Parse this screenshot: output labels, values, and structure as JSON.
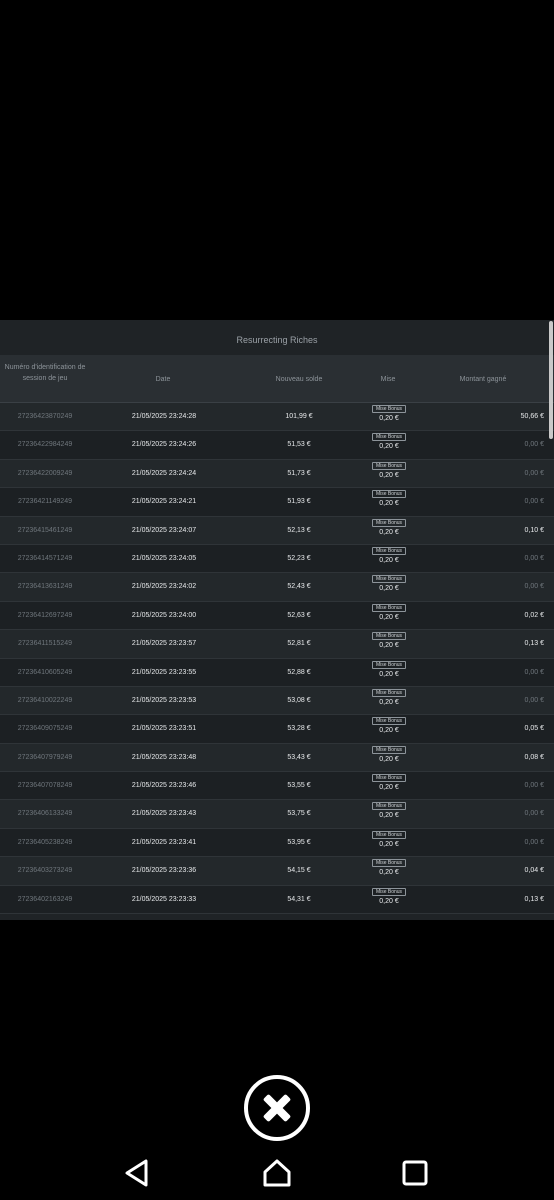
{
  "panel": {
    "title": "Resurrecting Riches",
    "headers": {
      "id": "Numéro d'identification de session de jeu",
      "date": "Date",
      "solde": "Nouveau solde",
      "mise": "Mise",
      "gain": "Montant gagné"
    },
    "mise_badge": "Mise Bonus",
    "rows": [
      {
        "id": "27236423870249",
        "date": "21/05/2025 23:24:28",
        "solde": "101,99 €",
        "mise": "0,20 €",
        "gain": "50,66 €"
      },
      {
        "id": "27236422984249",
        "date": "21/05/2025 23:24:26",
        "solde": "51,53 €",
        "mise": "0,20 €",
        "gain": "0,00 €"
      },
      {
        "id": "27236422009249",
        "date": "21/05/2025 23:24:24",
        "solde": "51,73 €",
        "mise": "0,20 €",
        "gain": "0,00 €"
      },
      {
        "id": "27236421149249",
        "date": "21/05/2025 23:24:21",
        "solde": "51,93 €",
        "mise": "0,20 €",
        "gain": "0,00 €"
      },
      {
        "id": "27236415461249",
        "date": "21/05/2025 23:24:07",
        "solde": "52,13 €",
        "mise": "0,20 €",
        "gain": "0,10 €"
      },
      {
        "id": "27236414571249",
        "date": "21/05/2025 23:24:05",
        "solde": "52,23 €",
        "mise": "0,20 €",
        "gain": "0,00 €"
      },
      {
        "id": "27236413631249",
        "date": "21/05/2025 23:24:02",
        "solde": "52,43 €",
        "mise": "0,20 €",
        "gain": "0,00 €"
      },
      {
        "id": "27236412697249",
        "date": "21/05/2025 23:24:00",
        "solde": "52,63 €",
        "mise": "0,20 €",
        "gain": "0,02 €"
      },
      {
        "id": "27236411515249",
        "date": "21/05/2025 23:23:57",
        "solde": "52,81 €",
        "mise": "0,20 €",
        "gain": "0,13 €"
      },
      {
        "id": "27236410605249",
        "date": "21/05/2025 23:23:55",
        "solde": "52,88 €",
        "mise": "0,20 €",
        "gain": "0,00 €"
      },
      {
        "id": "27236410022249",
        "date": "21/05/2025 23:23:53",
        "solde": "53,08 €",
        "mise": "0,20 €",
        "gain": "0,00 €"
      },
      {
        "id": "27236409075249",
        "date": "21/05/2025 23:23:51",
        "solde": "53,28 €",
        "mise": "0,20 €",
        "gain": "0,05 €"
      },
      {
        "id": "27236407979249",
        "date": "21/05/2025 23:23:48",
        "solde": "53,43 €",
        "mise": "0,20 €",
        "gain": "0,08 €"
      },
      {
        "id": "27236407078249",
        "date": "21/05/2025 23:23:46",
        "solde": "53,55 €",
        "mise": "0,20 €",
        "gain": "0,00 €"
      },
      {
        "id": "27236406133249",
        "date": "21/05/2025 23:23:43",
        "solde": "53,75 €",
        "mise": "0,20 €",
        "gain": "0,00 €"
      },
      {
        "id": "27236405238249",
        "date": "21/05/2025 23:23:41",
        "solde": "53,95 €",
        "mise": "0,20 €",
        "gain": "0,00 €"
      },
      {
        "id": "27236403273249",
        "date": "21/05/2025 23:23:36",
        "solde": "54,15 €",
        "mise": "0,20 €",
        "gain": "0,04 €"
      },
      {
        "id": "27236402163249",
        "date": "21/05/2025 23:23:33",
        "solde": "54,31 €",
        "mise": "0,20 €",
        "gain": "0,13 €"
      }
    ]
  },
  "icons": {
    "close": "close-circle-icon",
    "back": "back-triangle-icon",
    "home": "home-icon",
    "recents": "recents-square-icon"
  },
  "colors": {
    "panel_bg": "#1f2326",
    "header_bg": "#2a2f33",
    "text_primary": "#e8eaec",
    "text_muted": "#6f767c"
  }
}
